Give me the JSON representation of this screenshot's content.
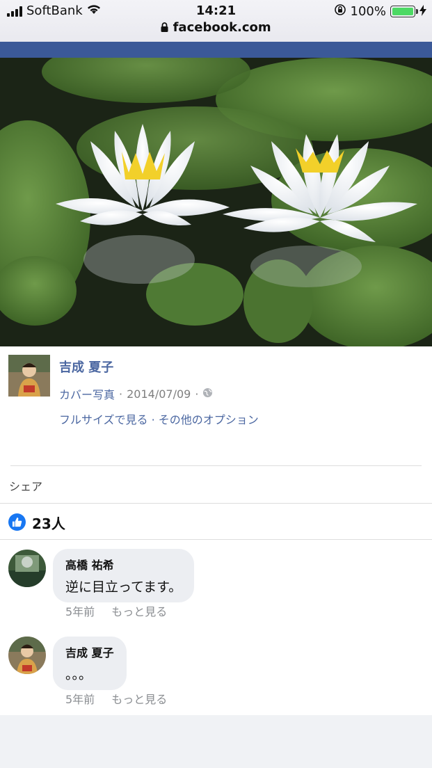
{
  "status_bar": {
    "carrier": "SoftBank",
    "time": "14:21",
    "url": "facebook.com",
    "battery": "100%"
  },
  "post": {
    "author": "吉成 夏子",
    "type_label": "カバー写真",
    "date": "2014/07/09",
    "options": "フルサイズで見る · その他のオプション",
    "share_label": "シェア",
    "like_count": "23人"
  },
  "comments": [
    {
      "name": "高橋 祐希",
      "text": "逆に目立ってます。",
      "time": "5年前",
      "more": "もっと見る"
    },
    {
      "name": "吉成 夏子",
      "text": "。。。",
      "time": "5年前",
      "more": "もっと見る"
    }
  ],
  "colors": {
    "facebook_blue": "#3b5998",
    "link": "#4b67a1",
    "like": "#1877f2",
    "battery": "#4cd964"
  },
  "icons": [
    "signal-icon",
    "wifi-icon",
    "lock-icon",
    "orientation-lock-icon",
    "battery-icon",
    "charging-bolt-icon",
    "globe-icon",
    "like-icon"
  ]
}
